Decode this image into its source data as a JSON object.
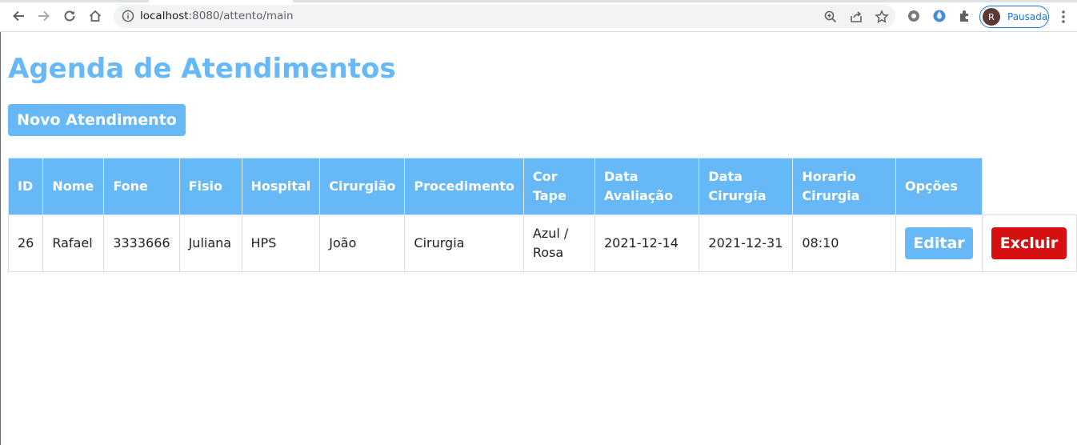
{
  "browser": {
    "url_host": "localhost",
    "url_rest": ":8080/attento/main",
    "profile_initial": "R",
    "profile_status": "Pausada"
  },
  "page": {
    "title": "Agenda de Atendimentos",
    "new_button": "Novo Atendimento"
  },
  "table": {
    "headers": {
      "id": "ID",
      "nome": "Nome",
      "fone": "Fone",
      "fisio": "Fisio",
      "hospital": "Hospital",
      "cirurgiao": "Cirurgião",
      "procedimento": "Procedimento",
      "cor_tape_1": "Cor",
      "cor_tape_2": "Tape",
      "data_avaliacao_1": "Data",
      "data_avaliacao_2": "Avaliação",
      "data_cirurgia_1": "Data",
      "data_cirurgia_2": "Cirurgia",
      "horario_cirurgia_1": "Horario",
      "horario_cirurgia_2": "Cirurgia",
      "opcoes": "Opções"
    },
    "rows": [
      {
        "id": "26",
        "nome": "Rafael",
        "fone": "3333666",
        "fisio": "Juliana",
        "hospital": "HPS",
        "cirurgiao": "João",
        "procedimento": "Cirurgia",
        "cor_tape_1": "Azul /",
        "cor_tape_2": "Rosa",
        "data_avaliacao": "2021-12-14",
        "data_cirurgia": "2021-12-31",
        "horario_cirurgia": "08:10",
        "edit_label": "Editar",
        "delete_label": "Excluir"
      }
    ]
  },
  "colors": {
    "accent": "#66b8f7",
    "danger": "#d61010"
  }
}
